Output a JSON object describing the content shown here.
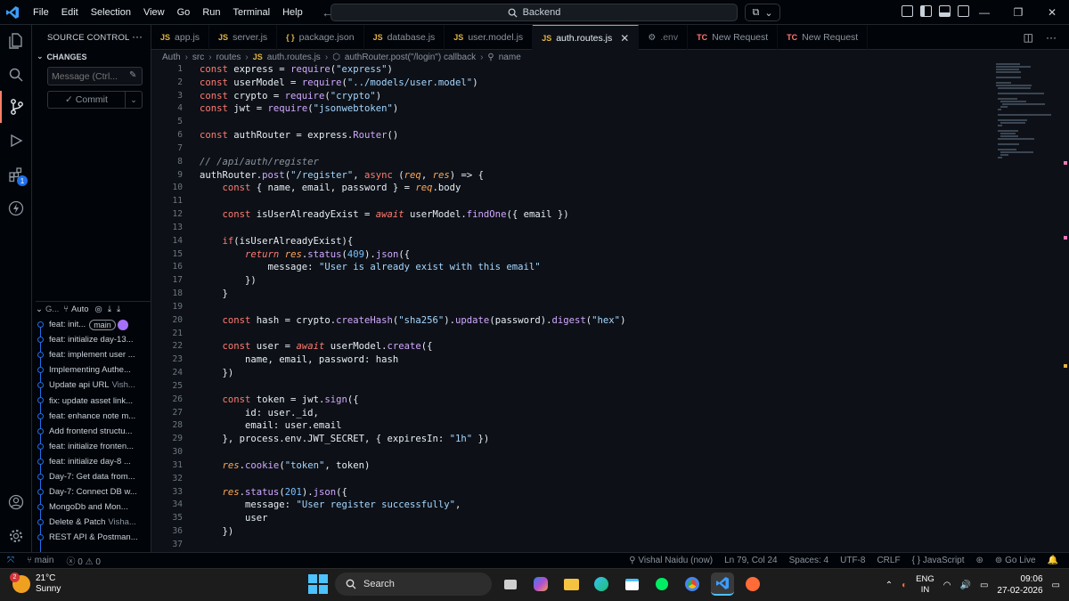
{
  "menu": [
    "File",
    "Edit",
    "Selection",
    "View",
    "Go",
    "Run",
    "Terminal",
    "Help"
  ],
  "command_center": "Backend",
  "sidebar": {
    "title": "SOURCE CONTROL",
    "changes_label": "CHANGES",
    "message_placeholder": "Message (Ctrl...",
    "commit_label": "Commit",
    "graph_title": "G...",
    "graph_auto": "Auto",
    "commits": [
      {
        "msg": "feat: init...",
        "author": "",
        "branch": "main"
      },
      {
        "msg": "feat: initialize day-13...",
        "author": ""
      },
      {
        "msg": "feat: implement user ...",
        "author": ""
      },
      {
        "msg": "Implementing Authe...",
        "author": ""
      },
      {
        "msg": "Update api URL",
        "author": "Vish..."
      },
      {
        "msg": "fix: update asset link...",
        "author": ""
      },
      {
        "msg": "feat: enhance note m...",
        "author": ""
      },
      {
        "msg": "Add frontend structu...",
        "author": ""
      },
      {
        "msg": "feat: initialize fronten...",
        "author": ""
      },
      {
        "msg": "feat: initialize day-8 ...",
        "author": ""
      },
      {
        "msg": "Day-7: Get data from...",
        "author": ""
      },
      {
        "msg": "Day-7: Connect DB w...",
        "author": ""
      },
      {
        "msg": "MongoDb and Mon...",
        "author": ""
      },
      {
        "msg": "Delete & Patch",
        "author": "Visha..."
      },
      {
        "msg": "REST API & Postman...",
        "author": ""
      }
    ]
  },
  "activity_badge": "1",
  "tabs": [
    {
      "label": "app.js",
      "icon": "JS",
      "kind": "js"
    },
    {
      "label": "server.js",
      "icon": "JS",
      "kind": "js"
    },
    {
      "label": "package.json",
      "icon": "{ }",
      "kind": "json"
    },
    {
      "label": "database.js",
      "icon": "JS",
      "kind": "js"
    },
    {
      "label": "user.model.js",
      "icon": "JS",
      "kind": "js"
    },
    {
      "label": "auth.routes.js",
      "icon": "JS",
      "kind": "js",
      "active": true
    },
    {
      "label": ".env",
      "icon": "⚙",
      "kind": "env"
    },
    {
      "label": "New Request",
      "icon": "TC",
      "kind": "tc"
    },
    {
      "label": "New Request",
      "icon": "TC",
      "kind": "tc"
    }
  ],
  "breadcrumb": [
    "Auth",
    "src",
    "routes",
    "auth.routes.js",
    "authRouter.post(\"/login\") callback",
    "name"
  ],
  "code": {
    "start_line": 1,
    "lines": [
      "const express = require(\"express\")",
      "const userModel = require(\"../models/user.model\")",
      "const crypto = require(\"crypto\")",
      "const jwt = require(\"jsonwebtoken\")",
      "",
      "const authRouter = express.Router()",
      "",
      "// /api/auth/register",
      "authRouter.post(\"/register\", async (req, res) => {",
      "    const { name, email, password } = req.body",
      "",
      "    const isUserAlreadyExist = await userModel.findOne({ email })",
      "",
      "    if(isUserAlreadyExist){",
      "        return res.status(409).json({",
      "            message: \"User is already exist with this email\"",
      "        })",
      "    }",
      "",
      "    const hash = crypto.createHash(\"sha256\").update(password).digest(\"hex\")",
      "",
      "    const user = await userModel.create({",
      "        name, email, password: hash",
      "    })",
      "",
      "    const token = jwt.sign({",
      "        id: user._id,",
      "        email: user.email",
      "    }, process.env.JWT_SECRET, { expiresIn: \"1h\" })",
      "",
      "    res.cookie(\"token\", token)",
      "",
      "    res.status(201).json({",
      "        message: \"User register successfully\",",
      "        user",
      "    })",
      ""
    ]
  },
  "status": {
    "branch": "main",
    "errors": "0",
    "warnings": "0",
    "author": "Vishal Naidu (now)",
    "position": "Ln 79, Col 24",
    "spaces": "Spaces: 4",
    "encoding": "UTF-8",
    "eol": "CRLF",
    "language": "JavaScript",
    "golive": "Go Live"
  },
  "taskbar": {
    "temp": "21°C",
    "weather": "Sunny",
    "weather_badge": "2",
    "search": "Search",
    "lang1": "ENG",
    "lang2": "IN",
    "time": "09:06",
    "date": "27-02-2026"
  },
  "colors": {
    "accent": "#f78166",
    "editor_bg": "#0d1117",
    "keyword": "#ff7b72",
    "function": "#d2a8ff",
    "string": "#a5d6ff"
  }
}
